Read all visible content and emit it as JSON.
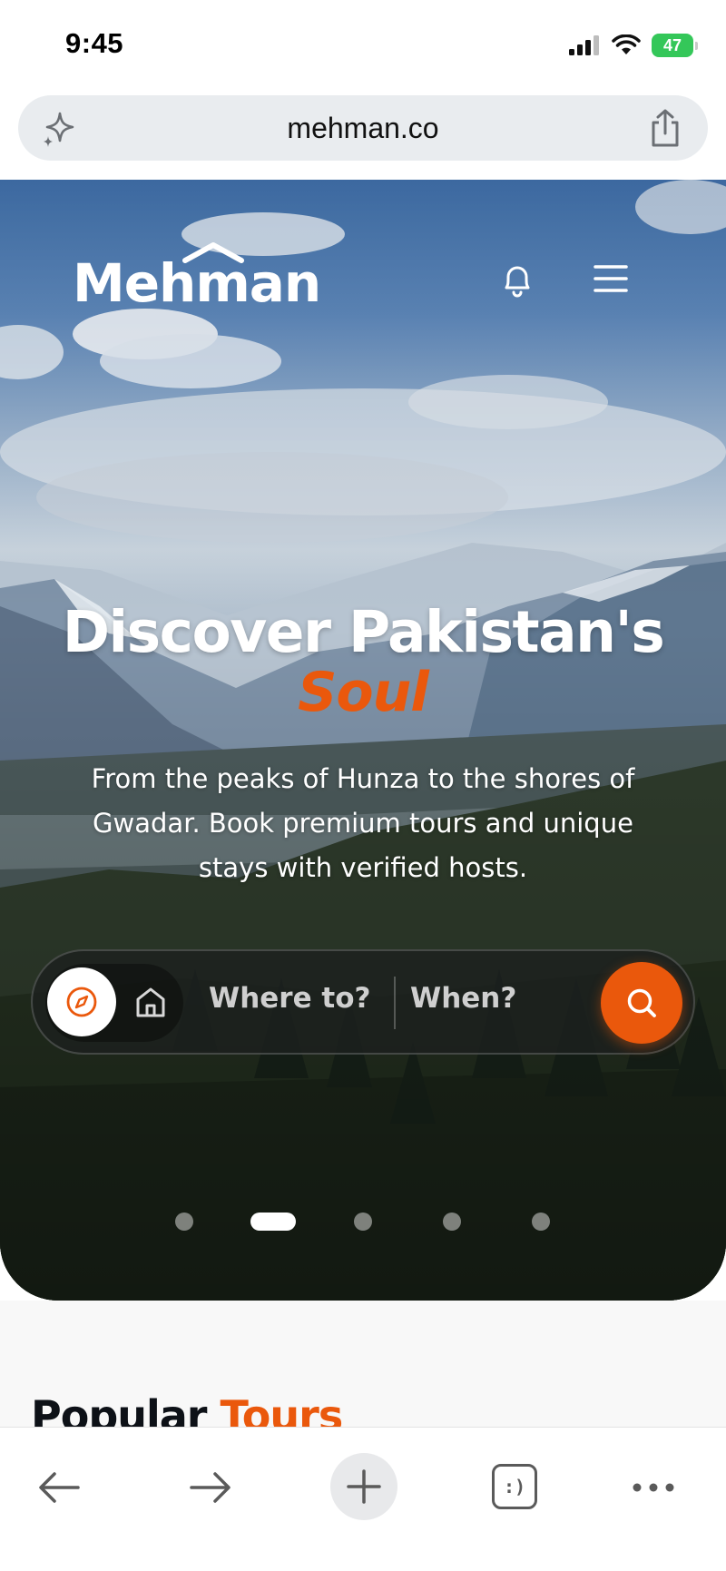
{
  "status_bar": {
    "time": "9:45",
    "battery": "47",
    "icons": [
      "signal-icon",
      "wifi-icon",
      "battery-charging-icon"
    ]
  },
  "browser": {
    "url": "mehman.co",
    "left_icon": "sparkle-icon",
    "right_icon": "share-icon"
  },
  "site": {
    "logo": "Mehman",
    "icons": [
      "bell-icon",
      "hamburger-menu-icon"
    ]
  },
  "hero": {
    "headline": "Discover Pakistan's",
    "headline_accent": "Soul",
    "subtitle": "From the peaks of Hunza to the shores of Gwadar. Book premium tours and unique stays with verified hosts.",
    "search": {
      "where_placeholder": "Where to?",
      "when_placeholder": "When?",
      "modes": [
        "explore-compass-icon",
        "stays-home-icon"
      ]
    },
    "carousel": {
      "slide_count": 5,
      "active_index": 1
    }
  },
  "section": {
    "title": "Popular",
    "title_accent": "Tours"
  },
  "toolbar": {
    "tabs_label": ":)",
    "buttons": [
      "back-arrow-icon",
      "forward-arrow-icon",
      "new-tab-plus-icon",
      "tabs-icon",
      "more-icon"
    ]
  },
  "colors": {
    "accent": "#ea580c",
    "url_bar": "#e9ecef",
    "battery": "#34c759"
  }
}
